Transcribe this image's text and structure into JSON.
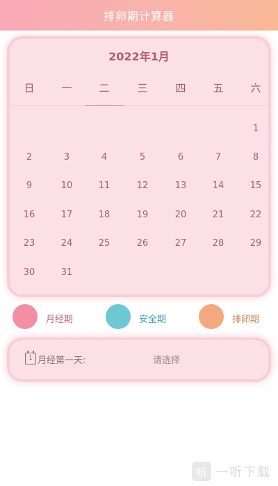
{
  "header": {
    "title": "排卵期计算器"
  },
  "calendar": {
    "month_title": "2022年1月",
    "weekdays": [
      "日",
      "一",
      "二",
      "三",
      "四",
      "五",
      "六"
    ],
    "days": [
      "1",
      "2",
      "3",
      "4",
      "5",
      "6",
      "7",
      "8",
      "9",
      "10",
      "11",
      "12",
      "13",
      "14",
      "15",
      "16",
      "17",
      "18",
      "19",
      "20",
      "21",
      "22",
      "23",
      "24",
      "25",
      "26",
      "27",
      "28",
      "29",
      "30",
      "31"
    ]
  },
  "legend": [
    {
      "label": "月经期",
      "color": "#f48fa3",
      "text_color": "#c56b80"
    },
    {
      "label": "安全期",
      "color": "#6cc8d2",
      "text_color": "#3aa4b0"
    },
    {
      "label": "排卵期",
      "color": "#f4a880",
      "text_color": "#c98755"
    }
  ],
  "info": {
    "icon_digit": "1",
    "first_day_label": "月经第一天:",
    "select_placeholder": "请选择"
  },
  "watermark": {
    "logo_char": "听",
    "text": "一听下载"
  }
}
